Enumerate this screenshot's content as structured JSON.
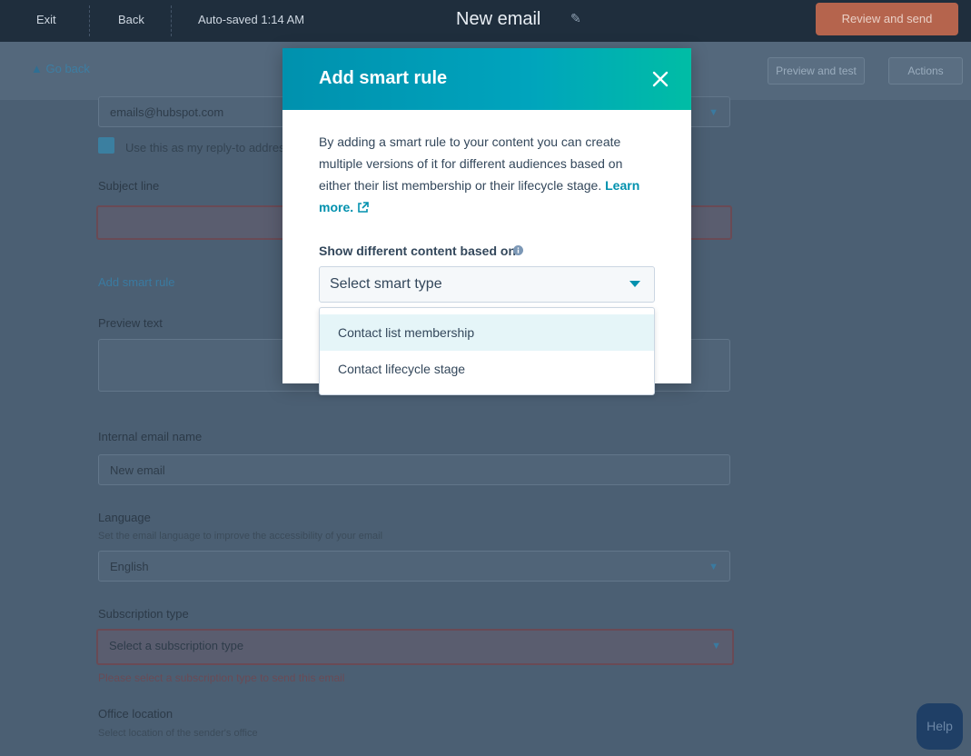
{
  "modal": {
    "title": "Add smart rule",
    "description": "By adding a smart rule to your content you can create multiple versions of it for different audiences based on either their list membership or their lifecycle stage.",
    "learn_more": "Learn more.",
    "select_label": "Show different content based on",
    "select_placeholder": "Select smart type",
    "options": [
      {
        "label": "Contact list membership",
        "highlighted": true
      },
      {
        "label": "Contact lifecycle stage",
        "highlighted": false
      }
    ]
  },
  "background": {
    "nav": {
      "exit": "Exit",
      "back": "Back",
      "autosave": "Auto-saved 1:14 AM",
      "page_title": "New email",
      "publish": "Review and send"
    },
    "subbar": {
      "back_link": "Go back",
      "btn1": "Preview and test",
      "btn2": "Actions"
    },
    "fields": {
      "from_address": "emails@hubspot.com",
      "checkbox_label": "Use this as my reply-to address",
      "subject_label": "Subject line",
      "personalization_link": "Add smart rule",
      "preview_label": "Preview text",
      "internal_name_label": "Internal email name",
      "internal_name_value": "New email",
      "language_label": "Language",
      "language_help": "Set the email language to improve the accessibility of your email",
      "language_value": "English",
      "subscription_label": "Subscription type",
      "subscription_placeholder": "Select a subscription type",
      "subscription_error": "Please select a subscription type to send this email",
      "office_label": "Office location",
      "office_help": "Select location of the sender's office"
    },
    "help": "Help"
  },
  "colors": {
    "header_start": "#0091ae",
    "header_end": "#00bda5",
    "link": "#0091ae",
    "text": "#33475b",
    "highlight": "#e5f5f8"
  }
}
